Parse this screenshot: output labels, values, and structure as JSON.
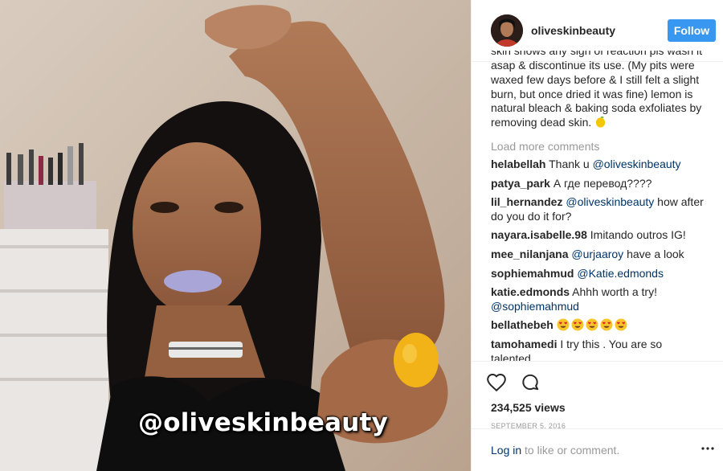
{
  "watermark": "@oliveskinbeauty",
  "header": {
    "username": "oliveskinbeauty",
    "follow_label": "Follow"
  },
  "caption": {
    "clipped_line": "skin shows any sign of reaction pls wash it",
    "lines": [
      "asap & discontinue its use. (My pits were",
      "waxed few days before & I still felt a slight",
      "burn, but once dried it was fine) lemon is",
      "natural bleach & baking soda exfoliates by"
    ],
    "last_line": "removing dead skin.",
    "emoji": "lemon-emoji"
  },
  "load_more": "Load more comments",
  "comments": [
    {
      "author": "helabellah",
      "text": "Thank u ",
      "mention": "@oliveskinbeauty",
      "after": ""
    },
    {
      "author": "patya_park",
      "text": "А где перевод????",
      "mention": "",
      "after": ""
    },
    {
      "author": "lil_hernandez",
      "text": "",
      "mention": "@oliveskinbeauty",
      "after": " how after do you do it for?"
    },
    {
      "author": "nayara.isabelle.98",
      "text": "Imitando outros IG!",
      "mention": "",
      "after": ""
    },
    {
      "author": "mee_nilanjana",
      "text": "",
      "mention": "@urjaaroy",
      "after": " have a look"
    },
    {
      "author": "sophiemahmud",
      "text": "",
      "mention": "@Katie.edmonds",
      "after": ""
    },
    {
      "author": "katie.edmonds",
      "text": "Ahhh worth a try! ",
      "mention": "@sophiemahmud",
      "after": ""
    },
    {
      "author": "bellathebeh",
      "text": "",
      "mention": "",
      "after": "",
      "emoji_count": 5,
      "emoji": "heart-eyes-emoji"
    },
    {
      "author": "tamohamedi",
      "text": "I try this . You are so talented",
      "mention": "",
      "after": ""
    }
  ],
  "actions": {
    "like_icon": "heart-icon",
    "comment_icon": "comment-bubble-icon",
    "views": "234,525 views",
    "date": "SEPTEMBER 5, 2016"
  },
  "footer": {
    "login_link": "Log in",
    "login_rest": " to like or comment.",
    "more_icon": "more-options-icon"
  },
  "colors": {
    "follow_blue": "#3897f0",
    "link_blue": "#003569",
    "muted_gray": "#999999",
    "divider": "#efefef"
  }
}
